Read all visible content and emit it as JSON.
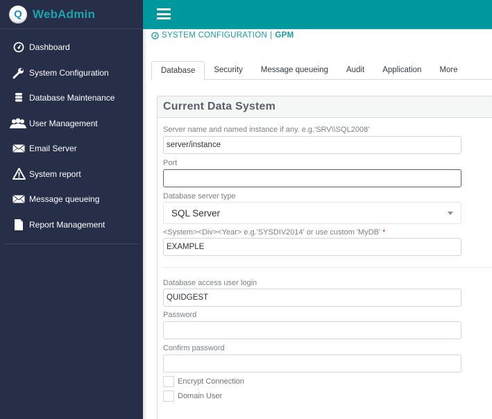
{
  "app": {
    "brand_initial": "Q",
    "brand_name": "WebAdmin"
  },
  "colors": {
    "sidebar_bg": "#272e48",
    "topbar_bg": "#00989f",
    "brand_text": "#1aa3b0",
    "accent_text": "#1a9aa3",
    "required_marker": "#d9262f"
  },
  "sidebar": {
    "items": [
      {
        "label": "Dashboard",
        "icon": "dashboard-gauge-icon"
      },
      {
        "label": "System Configuration",
        "icon": "wrench-icon"
      },
      {
        "label": "Database Maintenance",
        "icon": "database-icon"
      },
      {
        "label": "User Management",
        "icon": "users-icon"
      },
      {
        "label": "Email Server",
        "icon": "envelope-icon"
      },
      {
        "label": "System report",
        "icon": "warning-icon"
      },
      {
        "label": "Message queueing",
        "icon": "envelope-icon"
      },
      {
        "label": "Report Management",
        "icon": "file-icon"
      }
    ]
  },
  "topbar": {
    "menu_icon": "hamburger-menu-icon"
  },
  "breadcrumb": {
    "icon": "gauge-icon",
    "section": "SYSTEM CONFIGURATION",
    "separator": "|",
    "current": "GPM"
  },
  "tabs": [
    {
      "label": "Database",
      "active": true
    },
    {
      "label": "Security",
      "active": false
    },
    {
      "label": "Message queueing",
      "active": false
    },
    {
      "label": "Audit",
      "active": false
    },
    {
      "label": "Application",
      "active": false
    },
    {
      "label": "More",
      "active": false
    }
  ],
  "panel": {
    "title": "Current Data System",
    "fields": {
      "server": {
        "label": "Server name and named instance if any. e.g.'SRV\\\\SQL2008'",
        "value": "server/instance"
      },
      "port": {
        "label": "Port",
        "value": ""
      },
      "server_type": {
        "label": "Database server type",
        "value": "SQL Server"
      },
      "db_name": {
        "label": "<System><Div><Year> e.g.'SYSDIV2014' or use custom 'MyDB'",
        "required_marker": "*",
        "value": "EXAMPLE"
      },
      "login": {
        "label": "Database access user login",
        "value": "QUIDGEST"
      },
      "password": {
        "label": "Password",
        "value": ""
      },
      "confirm_password": {
        "label": "Confirm password",
        "value": ""
      }
    },
    "checkboxes": [
      {
        "label": "Encrypt Connection",
        "checked": false
      },
      {
        "label": "Domain User",
        "checked": false
      }
    ]
  }
}
